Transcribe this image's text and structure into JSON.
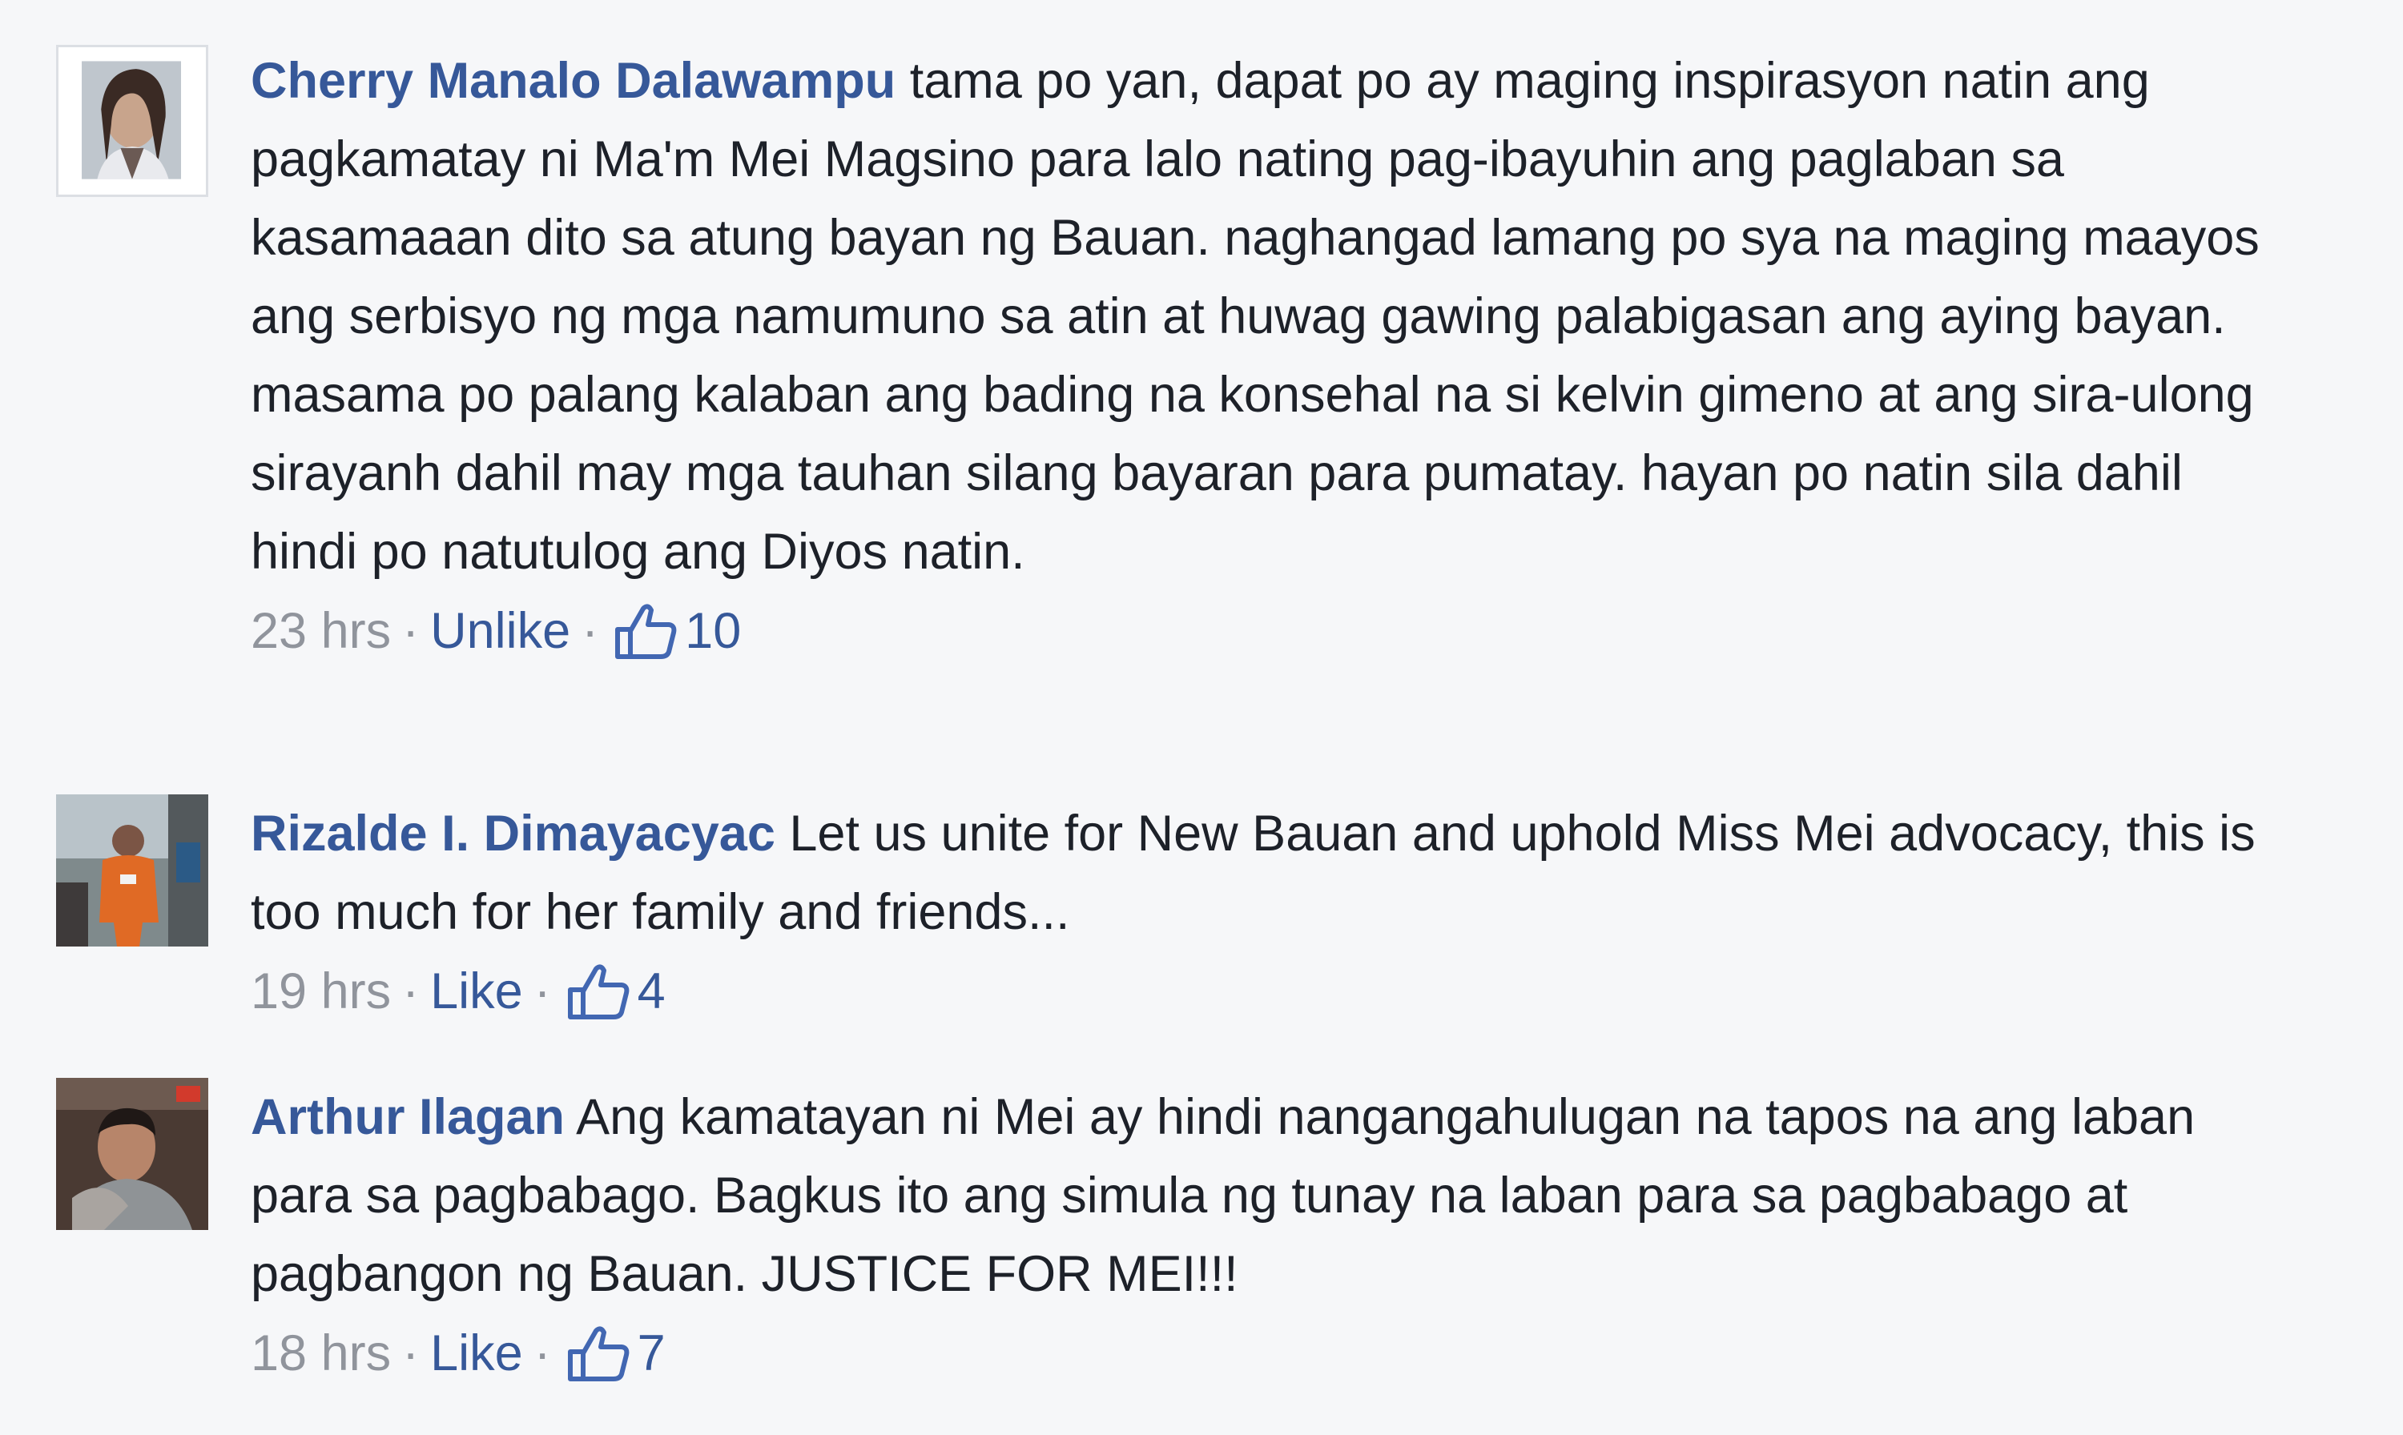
{
  "comments": [
    {
      "author": "Cherry Manalo Dalawampu",
      "text": "tama po yan, dapat po ay maging inspirasyon natin ang pagkamatay ni Ma'm Mei Magsino para lalo nating pag-ibayuhin ang paglaban sa kasamaaan dito sa atung bayan ng Bauan. naghangad lamang po sya na maging maayos ang serbisyo ng mga namumuno sa atin at huwag gawing palabigasan ang aying bayan. masama po palang kalaban ang bading na konsehal na si kelvin gimeno at ang sira-ulong sirayanh dahil may mga tauhan silang bayaran para pumatay. hayan po natin sila dahil hindi po natutulog ang Diyos natin.",
      "time": "23 hrs",
      "action": "Unlike",
      "like_icon": "thumbs-up-icon",
      "likes": "10"
    },
    {
      "author": "Rizalde I. Dimayacyac",
      "text": "Let us unite for New Bauan and uphold Miss Mei advocacy, this is too much for her family and friends...",
      "time": "19 hrs",
      "action": "Like",
      "like_icon": "thumbs-up-icon",
      "likes": "4"
    },
    {
      "author": "Arthur Ilagan",
      "text": "Ang kamatayan ni Mei ay hindi nangangahulugan na tapos na ang laban para sa pagbabago. Bagkus ito ang simula ng tunay na laban para sa pagbabago at pagbangon ng Bauan. JUSTICE FOR MEI!!!",
      "time": "18 hrs",
      "action": "Like",
      "like_icon": "thumbs-up-icon",
      "likes": "7"
    }
  ],
  "separator": "·",
  "colors": {
    "background": "#f6f7f9",
    "link": "#365899",
    "text": "#1d2129",
    "meta": "#90949c"
  }
}
